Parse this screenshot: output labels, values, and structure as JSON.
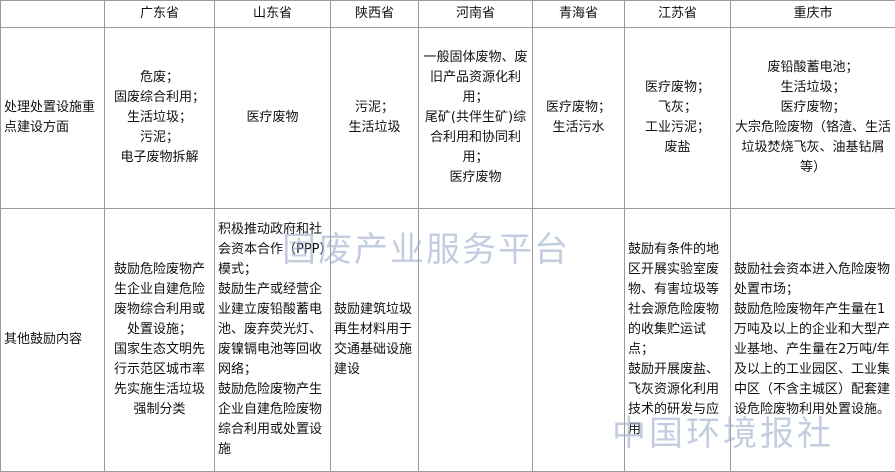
{
  "watermarks": [
    "固废产业服务平台",
    "中国环境报社"
  ],
  "header": [
    "",
    "广东省",
    "山东省",
    "陕西省",
    "河南省",
    "青海省",
    "江苏省",
    "重庆市"
  ],
  "rows": [
    {
      "label": "处理处置设施重点建设方面",
      "cells": [
        [
          "危废；",
          "固废综合利用；",
          "生活垃圾；",
          "污泥；",
          "电子废物拆解"
        ],
        [
          "医疗废物"
        ],
        [
          "污泥；",
          "生活垃圾"
        ],
        [
          "一般固体废物、废旧产品资源化利用；",
          "尾矿(共伴生矿)综合利用和协同利用；",
          "医疗废物"
        ],
        [
          "医疗废物；",
          "生活污水"
        ],
        [
          "医疗废物；",
          "飞灰；",
          "工业污泥；",
          "废盐"
        ],
        [
          "废铅酸蓄电池；",
          "生活垃圾；",
          "医疗废物；",
          "大宗危险废物（铬渣、生活垃圾焚烧飞灰、油基钻屑等）"
        ]
      ]
    },
    {
      "label": "其他鼓励内容",
      "cells": [
        [
          "鼓励危险废物产生企业自建危险废物综合利用或处置设施；",
          "国家生态文明先行示范区城市率先实施生活垃圾强制分类"
        ],
        [
          "积极推动政府和社会资本合作（PPP）模式；",
          "鼓励生产或经营企业建立废铅酸蓄电池、废弃荧光灯、废镍镉电池等回收网络；",
          "鼓励危险废物产生企业自建危险废物综合利用或处置设施"
        ],
        [
          "鼓励建筑垃圾再生材料用于交通基础设施建设"
        ],
        [],
        [],
        [
          "鼓励有条件的地区开展实验室废物、有害垃圾等社会源危险废物的收集贮运试点；",
          "鼓励开展废盐、飞灰资源化利用技术的研发与应用"
        ],
        [
          "鼓励社会资本进入危险废物处置市场；",
          "鼓励危险废物年产生量在1万吨及以上的企业和大型产业基地、产生量在2万吨/年及以上的工业园区、工业集中区（不含主城区）配套建设危险废物利用处置设施。"
        ]
      ]
    }
  ]
}
